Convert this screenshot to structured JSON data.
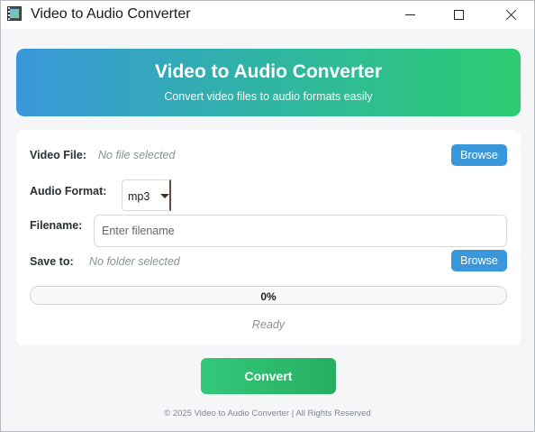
{
  "window": {
    "title": "Video to Audio Converter"
  },
  "header": {
    "title": "Video to Audio Converter",
    "subtitle": "Convert video files to audio formats easily"
  },
  "form": {
    "video_file": {
      "label": "Video File:",
      "value": "No file selected",
      "button": "Browse"
    },
    "audio_format": {
      "label": "Audio Format:",
      "selected": "mp3"
    },
    "filename": {
      "label": "Filename:",
      "value": "",
      "placeholder": "Enter filename"
    },
    "save_to": {
      "label": "Save to:",
      "value": "No folder selected",
      "button": "Browse"
    },
    "progress": {
      "value": 0,
      "text": "0%"
    },
    "status": "Ready"
  },
  "actions": {
    "convert_label": "Convert"
  },
  "footer": {
    "text": "© 2025 Video to Audio Converter | All Rights Reserved"
  },
  "colors": {
    "accent_blue": "#3a97db",
    "accent_green": "#2ecc71",
    "background": "#f5f6f8"
  },
  "icons": {
    "app": "app-icon",
    "minimize": "minimize-icon",
    "maximize": "maximize-icon",
    "close": "close-icon",
    "dropdown": "chevron-down-icon"
  }
}
